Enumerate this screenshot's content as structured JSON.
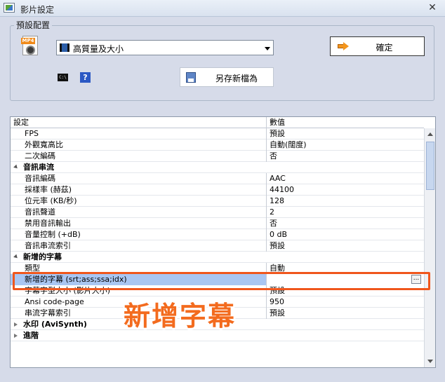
{
  "window": {
    "title": "影片設定"
  },
  "preset": {
    "group_label": "預設配置",
    "selected": "高質量及大小",
    "ok_label": "確定",
    "saveas_label": "另存新檔為",
    "cmd_icon_text": "C:\\",
    "help_icon_text": "?"
  },
  "grid": {
    "col_name": "設定",
    "col_value": "數值",
    "rows": [
      {
        "name": "FPS",
        "value": "預設"
      },
      {
        "name": "外觀寬高比",
        "value": "自動(闊度)"
      },
      {
        "name": "二次編碼",
        "value": "否"
      },
      {
        "name": "音訊串流",
        "value": ""
      },
      {
        "name": "音訊編碼",
        "value": "AAC"
      },
      {
        "name": "採樣率 (赫茲)",
        "value": "44100"
      },
      {
        "name": "位元率 (KB/秒)",
        "value": "128"
      },
      {
        "name": "音訊聲道",
        "value": "2"
      },
      {
        "name": "禁用音訊輸出",
        "value": "否"
      },
      {
        "name": "音量控制 (+dB)",
        "value": "0 dB"
      },
      {
        "name": "音訊串流索引",
        "value": "預設"
      },
      {
        "name": "新增的字幕",
        "value": ""
      },
      {
        "name": "類型",
        "value": "自動"
      },
      {
        "name": "新增的字幕 (srt;ass;ssa;idx)",
        "value": "",
        "button": "..."
      },
      {
        "name": "字幕字型大小 (影片大小)",
        "value": "預設"
      },
      {
        "name": "Ansi code-page",
        "value": "950"
      },
      {
        "name": "串流字幕索引",
        "value": "預設"
      },
      {
        "name": "水印 (AviSynth)",
        "value": ""
      },
      {
        "name": "進階",
        "value": ""
      }
    ]
  },
  "annotation": {
    "text": "新增字幕"
  },
  "colors": {
    "highlight": "#f0561c",
    "annotation": "#f36b1e",
    "selection": "#a9c6f2"
  }
}
